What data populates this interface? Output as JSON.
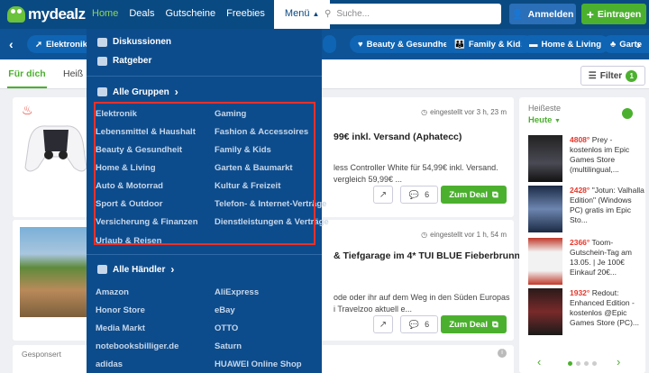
{
  "header": {
    "logo_text": "mydealz",
    "nav": [
      "Home",
      "Deals",
      "Gutscheine",
      "Freebies"
    ],
    "menu_label": "Menü",
    "search_placeholder": "Suche...",
    "login_label": "Anmelden",
    "post_label": "Eintragen"
  },
  "categories": [
    "Elektronik",
    "Beauty & Gesundheit",
    "Family & Kids",
    "Home & Living",
    "Garte"
  ],
  "tabs": [
    "Für dich",
    "Heiß"
  ],
  "filter": {
    "label": "Filter",
    "count": "1"
  },
  "deals": [
    {
      "time": "eingestellt vor 3 h, 23 m",
      "title": "99€ inkl. Versand (Aphatecc)",
      "desc1": "less Controller White für 54,99€ inkl. Versand.",
      "desc2": "vergleich 59,99€ ...",
      "comments": "6",
      "cta": "Zum Deal"
    },
    {
      "time": "eingestellt vor 1 h, 54 m",
      "title": "& Tiefgarage im 4* TUI BLUE Fieberbrunn",
      "desc1": "ode oder ihr auf dem Weg in den Süden Europas",
      "desc2": "i Travelzoo aktuell e...",
      "comments": "6",
      "cta": "Zum Deal"
    }
  ],
  "sponsored": "Gesponsert",
  "sidebar": {
    "heading": "Heißeste",
    "selected": "Heute",
    "items": [
      {
        "temp": "4808°",
        "text": "Prey - kostenlos im Epic Games Store (multilingual,..."
      },
      {
        "temp": "2428°",
        "text": "\"Jotun: Valhalla Edition\" (Windows PC) gratis im Epic Sto..."
      },
      {
        "temp": "2366°",
        "text": "Toom-Gutschein-Tag am 13.05. | Je 100€ Einkauf 20€..."
      },
      {
        "temp": "1932°",
        "text": "Redout: Enhanced Edition - kostenlos @Epic Games Store (PC)..."
      }
    ]
  },
  "dropdown": {
    "top_items": [
      "Diskussionen",
      "Ratgeber"
    ],
    "groups_label": "Alle Gruppen",
    "groups_left": [
      "Elektronik",
      "Lebensmittel & Haushalt",
      "Beauty & Gesundheit",
      "Home & Living",
      "Auto & Motorrad",
      "Sport & Outdoor",
      "Versicherung & Finanzen",
      "Urlaub & Reisen"
    ],
    "groups_right": [
      "Gaming",
      "Fashion & Accessoires",
      "Family & Kids",
      "Garten & Baumarkt",
      "Kultur & Freizeit",
      "Telefon- & Internet-Verträge",
      "Dienstleistungen & Verträge"
    ],
    "merchants_label": "Alle Händler",
    "merchants_left": [
      "Amazon",
      "Honor Store",
      "Media Markt",
      "notebooksbilliger.de",
      "adidas"
    ],
    "merchants_right": [
      "AliExpress",
      "eBay",
      "OTTO",
      "Saturn",
      "HUAWEI Online Shop"
    ]
  },
  "colors": {
    "header": "#0a4a82",
    "accent": "#4cb02f",
    "hot": "#e5372b"
  }
}
